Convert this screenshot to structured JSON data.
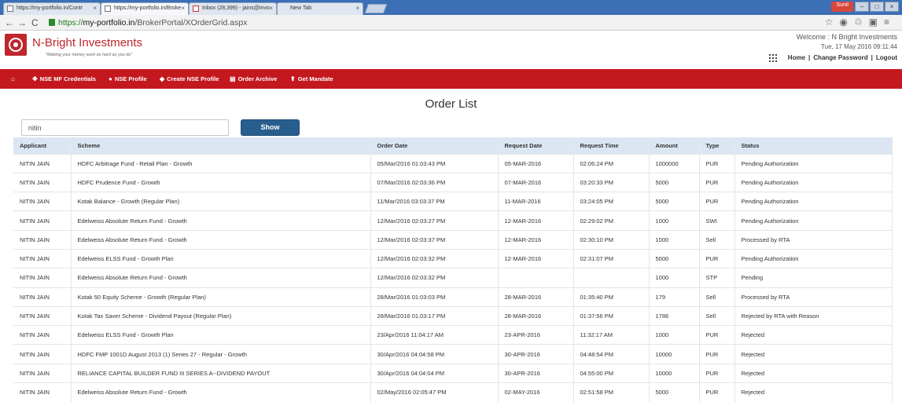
{
  "browser": {
    "tabs": [
      {
        "title": "https://my-portfolio.in/Contr",
        "active": false
      },
      {
        "title": "https://my-portfolio.in/Broke",
        "active": true
      },
      {
        "title": "Inbox (28,399) - jains@invo",
        "active": false
      },
      {
        "title": "New Tab",
        "active": false
      }
    ],
    "user": "Sunil",
    "url_scheme": "https://",
    "url_host": "my-portfolio.in",
    "url_path": "/BrokerPortal/XOrderGrid.aspx"
  },
  "header": {
    "brand": "N-Bright Investments",
    "tagline": "\"Making your money work as hard as you do\"",
    "welcome": "Welcome : N Bright Investments",
    "datetime": "Tue, 17 May 2016 09:11:44",
    "links": {
      "home": "Home",
      "change_password": "Change Password",
      "logout": "Logout"
    }
  },
  "menu": {
    "items": [
      {
        "label": "NSE MF Credentials",
        "icon": "users-icon"
      },
      {
        "label": "NSE Profile",
        "icon": "comments-icon"
      },
      {
        "label": "Create NSE Profile",
        "icon": "comment-plus-icon"
      },
      {
        "label": "Order Archive",
        "icon": "file-icon"
      },
      {
        "label": "Get Mandate",
        "icon": "arrow-up-icon"
      }
    ]
  },
  "main": {
    "title": "Order List",
    "search_value": "nitin",
    "show_label": "Show",
    "columns": [
      "Applicant",
      "Scheme",
      "Order Date",
      "Request Date",
      "Request Time",
      "Amount",
      "Type",
      "Status"
    ],
    "rows": [
      [
        "NITIN JAIN",
        "HDFC Arbitrage Fund - Retail Plan - Growth",
        "05/Mar/2016 01:03:43 PM",
        "05-MAR-2016",
        "02:06:24 PM",
        "1000000",
        "PUR",
        "Pending Authorization"
      ],
      [
        "NITIN JAIN",
        "HDFC Prudence Fund - Growth",
        "07/Mar/2016 02:03:36 PM",
        "07-MAR-2016",
        "03:20:33 PM",
        "5000",
        "PUR",
        "Pending Authorization"
      ],
      [
        "NITIN JAIN",
        "Kotak Balance - Growth (Regular Plan)",
        "11/Mar/2016 03:03:37 PM",
        "11-MAR-2016",
        "03:24:05 PM",
        "5000",
        "PUR",
        "Pending Authorization"
      ],
      [
        "NITIN JAIN",
        "Edelweiss Absolute Return Fund - Growth",
        "12/Mar/2016 02:03:27 PM",
        "12-MAR-2016",
        "02:29:02 PM",
        "1000",
        "SWI",
        "Pending Authorization"
      ],
      [
        "NITIN JAIN",
        "Edelweiss Absolute Return Fund - Growth",
        "12/Mar/2016 02:03:37 PM",
        "12-MAR-2016",
        "02:30:10 PM",
        "1000",
        "Sell",
        "Processed by RTA"
      ],
      [
        "NITIN JAIN",
        "Edelweiss ELSS Fund - Growth Plan",
        "12/Mar/2016 02:03:32 PM",
        "12-MAR-2016",
        "02:31:07 PM",
        "5000",
        "PUR",
        "Pending Authorization"
      ],
      [
        "NITIN JAIN",
        "Edelweiss Absolute Return Fund - Growth",
        "12/Mar/2016 02:03:32 PM",
        "",
        "",
        "1000",
        "STP",
        "Pending"
      ],
      [
        "NITIN JAIN",
        "Kotak 50 Equity Scheme - Growth (Regular Plan)",
        "28/Mar/2016 01:03:03 PM",
        "28-MAR-2016",
        "01:35:40 PM",
        "179",
        "Sell",
        "Processed by RTA"
      ],
      [
        "NITIN JAIN",
        "Kotak Tax Saver Scheme - Dividend Payout (Regular Plan)",
        "28/Mar/2016 01:03:17 PM",
        "28-MAR-2016",
        "01:37:56 PM",
        "1786",
        "Sell",
        "Rejected by RTA with Reason"
      ],
      [
        "NITIN JAIN",
        "Edelweiss ELSS Fund - Growth Plan",
        "23/Apr/2016 11:04:17 AM",
        "23-APR-2016",
        "11:32:17 AM",
        "1000",
        "PUR",
        "Rejected"
      ],
      [
        "NITIN JAIN",
        "HDFC FMP 1001D August 2013 (1) Series 27 - Regular - Growth",
        "30/Apr/2016 04:04:58 PM",
        "30-APR-2016",
        "04:48:54 PM",
        "10000",
        "PUR",
        "Rejected"
      ],
      [
        "NITIN JAIN",
        "RELIANCE CAPITAL BUILDER FUND III SERIES A--DIVIDEND PAYOUT",
        "30/Apr/2016 04:04:04 PM",
        "30-APR-2016",
        "04:55:00 PM",
        "10000",
        "PUR",
        "Rejected"
      ],
      [
        "NITIN JAIN",
        "Edelweiss Absolute Return Fund - Growth",
        "02/May/2016 02:05:47 PM",
        "02-MAY-2016",
        "02:51:58 PM",
        "5000",
        "PUR",
        "Rejected"
      ]
    ]
  },
  "colors": {
    "brand_red": "#c0262d",
    "menu_red": "#c4181f",
    "button_blue": "#285e8e",
    "table_header_bg": "#dce6f3"
  }
}
